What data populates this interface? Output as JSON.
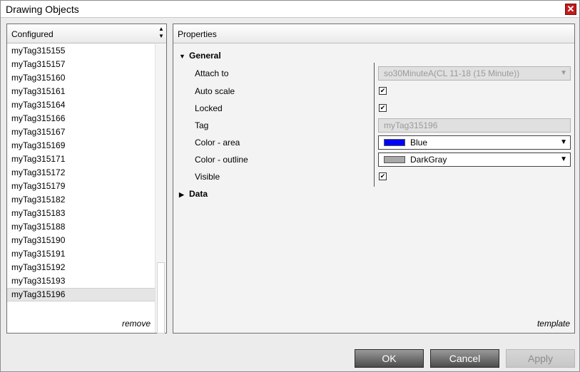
{
  "window": {
    "title": "Drawing Objects",
    "close_glyph": "✕"
  },
  "left_panel": {
    "header": "Configured",
    "items": [
      "myTag315155",
      "myTag315157",
      "myTag315160",
      "myTag315161",
      "myTag315164",
      "myTag315166",
      "myTag315167",
      "myTag315169",
      "myTag315171",
      "myTag315172",
      "myTag315179",
      "myTag315182",
      "myTag315183",
      "myTag315188",
      "myTag315190",
      "myTag315191",
      "myTag315192",
      "myTag315193",
      "myTag315196"
    ],
    "selected_item": "myTag315196",
    "remove_label": "remove"
  },
  "right_panel": {
    "header": "Properties",
    "general_label": "General",
    "data_label": "Data",
    "template_label": "template",
    "props": {
      "attach_to": {
        "label": "Attach to",
        "value": "so30MinuteA(CL 11-18 (15 Minute))"
      },
      "auto_scale": {
        "label": "Auto scale",
        "checked": true
      },
      "locked": {
        "label": "Locked",
        "checked": true
      },
      "tag": {
        "label": "Tag",
        "value": "myTag315196"
      },
      "color_area": {
        "label": "Color - area",
        "value": "Blue",
        "swatch": "#0000ff"
      },
      "color_outline": {
        "label": "Color - outline",
        "value": "DarkGray",
        "swatch": "#a9a9a9"
      },
      "visible": {
        "label": "Visible",
        "checked": true
      }
    }
  },
  "buttons": {
    "ok": "OK",
    "cancel": "Cancel",
    "apply": "Apply"
  },
  "glyphs": {
    "expanded": "▼",
    "collapsed": "▶",
    "dropdown": "▼",
    "check": "✔",
    "sort_up": "▲",
    "sort_down": "▼"
  }
}
